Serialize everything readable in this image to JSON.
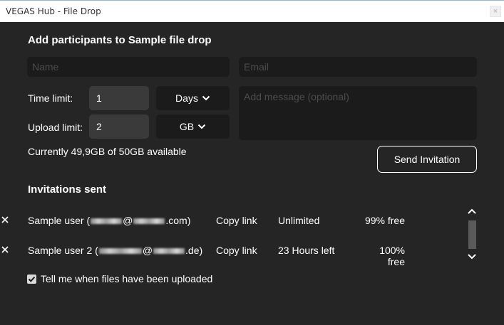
{
  "window": {
    "title": "VEGAS Hub - File Drop",
    "close_label": "×"
  },
  "form": {
    "heading": "Add participants to Sample file drop",
    "name_placeholder": "Name",
    "email_placeholder": "Email",
    "message_placeholder": "Add message (optional)",
    "time_limit_label": "Time limit:",
    "time_limit_value": "1",
    "time_unit": "Days",
    "upload_limit_label": "Upload limit:",
    "upload_limit_value": "2",
    "upload_unit": "GB",
    "available_text": "Currently 49,9GB of 50GB available",
    "send_button": "Send Invitation"
  },
  "invitations": {
    "heading": "Invitations sent",
    "rows": [
      {
        "user_prefix": "Sample user (",
        "email_mid": "@",
        "email_suffix": ".com)",
        "copy": "Copy link",
        "time": "Unlimited",
        "free": "99% free"
      },
      {
        "user_prefix": "Sample user 2 (",
        "email_mid": "@",
        "email_suffix": ".de)",
        "copy": "Copy link",
        "time": "23 Hours left",
        "free": "100% free"
      }
    ]
  },
  "notify": {
    "label": "Tell me when files have been uploaded",
    "checked": true
  },
  "colors": {
    "background": "#252525",
    "input_bg": "#1b1b1b",
    "number_bg": "#3a3a3a",
    "text": "#ffffff"
  },
  "icons": {
    "dropdown": "chevron-down-icon",
    "remove": "close-icon",
    "scroll_up": "chevron-up-icon",
    "scroll_down": "chevron-down-icon",
    "check": "checkmark-icon"
  }
}
